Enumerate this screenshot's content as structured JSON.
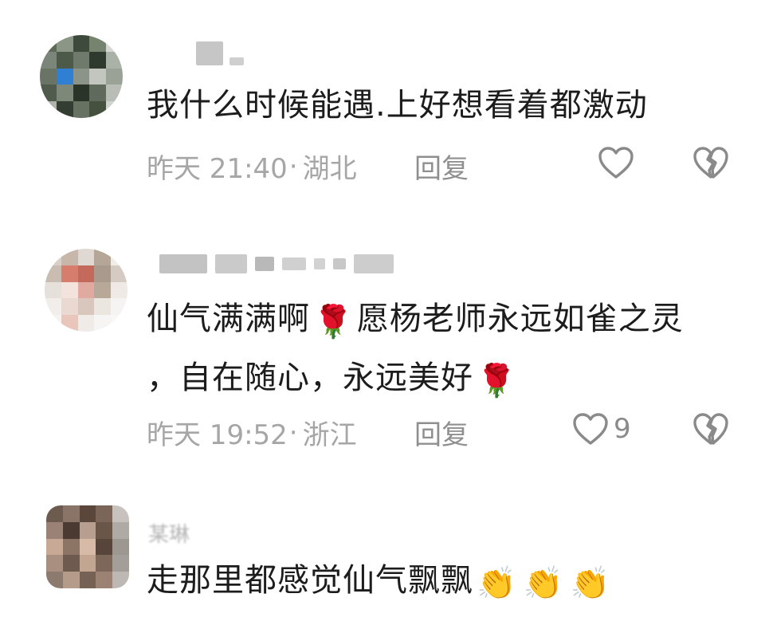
{
  "comments": [
    {
      "text": "我什么时候能遇.上好想看着都激动",
      "time": "昨天 21:40",
      "location": "湖北",
      "reply_label": "回复",
      "like_count": ""
    },
    {
      "text_line1": "仙气满满啊",
      "text_line1b": "愿杨老师永远如雀之灵",
      "text_line2": "，自在随心，永远美好",
      "emoji": "🌹",
      "time": "昨天 19:52",
      "location": "浙江",
      "reply_label": "回复",
      "like_count": "9"
    },
    {
      "username_partial": "某琳",
      "text": "走那里都感觉仙气飘飘",
      "emoji": "👏"
    }
  ],
  "separator": "·",
  "icons": {
    "like": "heart-outline-icon",
    "dislike": "broken-heart-icon",
    "rose": "rose-emoji",
    "clap": "clapping-hands-emoji"
  },
  "colors": {
    "text": "#1c1c1c",
    "meta": "#a6a6a6",
    "icon": "#8a8a8a"
  }
}
